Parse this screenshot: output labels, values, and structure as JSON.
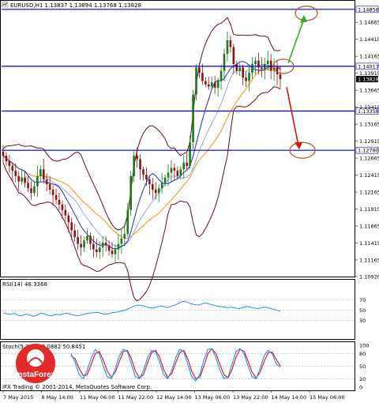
{
  "header": {
    "symbol_line": "EURUSD,H1  1.13837 1.13894 1.13768 1.13828",
    "rsi_label": "RSI(14) 48.3368",
    "stoch_label": "Stoch(5,3,3) 48.0882 50.8451",
    "copyright": "IFX Trading © 2001-2014, MetaQuotes Software Corp."
  },
  "logo": {
    "text": "InstaForex"
  },
  "price_axis": {
    "ticks": [
      "1.14665",
      "1.14415",
      "1.14165",
      "1.13915",
      "1.13665",
      "1.13415",
      "1.13165",
      "1.12915",
      "1.12665",
      "1.12415",
      "1.12165",
      "1.11915",
      "1.11665",
      "1.11415",
      "1.11165",
      "1.10920"
    ],
    "ylim": [
      1.1092,
      1.1497
    ]
  },
  "price_tags": [
    {
      "label": "1.14856",
      "value": 1.14856,
      "style": "level"
    },
    {
      "label": "1.14017",
      "value": 1.14017,
      "style": "level"
    },
    {
      "label": "1.13828",
      "value": 1.13828,
      "style": "current"
    },
    {
      "label": "1.13358",
      "value": 1.13358,
      "style": "level"
    },
    {
      "label": "1.12780",
      "value": 1.1278,
      "style": "level"
    }
  ],
  "rsi_axis": {
    "ticks": [
      "70",
      "50",
      "30"
    ],
    "ylim": [
      0,
      100
    ]
  },
  "stoch_axis": {
    "ticks": [
      "100",
      "80",
      "50",
      "20",
      "0"
    ],
    "ylim": [
      0,
      100
    ]
  },
  "time_axis": {
    "labels": [
      "7 May 2015",
      "8 May 14:00",
      "11 May 06:00",
      "11 May 22:00",
      "12 May 14:00",
      "13 May 06:00",
      "13 May 22:00",
      "14 May 14:00",
      "15 May 06:00"
    ]
  },
  "colors": {
    "bull": "#1a7a1a",
    "bear": "#8b1414",
    "bands": "#6b0f0f",
    "ma_fast": "#1c2fc4",
    "ma_slow": "#e8a020",
    "level_line": "#0000cc",
    "arrow_up": "#2bb02b",
    "arrow_down": "#e01010",
    "circle": "#b06030",
    "rsi": "#1e90ff",
    "stoch_main": "#1e90ff",
    "stoch_signal": "#e01010"
  },
  "chart_data": {
    "type": "candlestick",
    "title": "EURUSD,H1",
    "ylim": [
      1.1092,
      1.1497
    ],
    "closes": [
      1.127,
      1.1262,
      1.1255,
      1.1248,
      1.124,
      1.1232,
      1.1238,
      1.123,
      1.1222,
      1.1215,
      1.1225,
      1.124,
      1.125,
      1.1235,
      1.1228,
      1.122,
      1.1212,
      1.1205,
      1.1198,
      1.119,
      1.1182,
      1.1172,
      1.116,
      1.115,
      1.114,
      1.1135,
      1.1145,
      1.1152,
      1.114,
      1.1132,
      1.1128,
      1.1135,
      1.1142,
      1.1138,
      1.113,
      1.1125,
      1.1132,
      1.114,
      1.1148,
      1.1155,
      1.119,
      1.124,
      1.127,
      1.1265,
      1.125,
      1.1242,
      1.1235,
      1.1228,
      1.122,
      1.1215,
      1.1222,
      1.123,
      1.1238,
      1.1245,
      1.1252,
      1.1248,
      1.124,
      1.125,
      1.126,
      1.1255,
      1.129,
      1.136,
      1.14,
      1.1392,
      1.138,
      1.1375,
      1.1372,
      1.1378,
      1.137,
      1.138,
      1.1395,
      1.142,
      1.144,
      1.143,
      1.1405,
      1.1395,
      1.14,
      1.1385,
      1.138,
      1.1392,
      1.1405,
      1.141,
      1.14,
      1.1398,
      1.1405,
      1.141,
      1.1395,
      1.14,
      1.139,
      1.1383
    ],
    "rsi": [
      45,
      43,
      42,
      44,
      40,
      39,
      42,
      41,
      38,
      40,
      44,
      43,
      40,
      39,
      42,
      41,
      43,
      44,
      42,
      40,
      39,
      41,
      43,
      44,
      45,
      46,
      44,
      42,
      43,
      45,
      46,
      47,
      49,
      51,
      55,
      58,
      60,
      59,
      57,
      55,
      54,
      56,
      58,
      57,
      55,
      58,
      60,
      64,
      67,
      66,
      63,
      61,
      60,
      62,
      64,
      62,
      60,
      58,
      57,
      56,
      55,
      56,
      54,
      53,
      55,
      57,
      56,
      54,
      53,
      55,
      56,
      54,
      52,
      50,
      48
    ],
    "stoch_main": [
      80,
      60,
      30,
      20,
      40,
      70,
      90,
      80,
      50,
      25,
      20,
      45,
      75,
      90,
      85,
      55,
      25,
      20,
      40,
      70,
      88,
      85,
      60,
      30,
      20,
      40,
      70,
      90,
      85,
      55,
      25,
      15,
      30,
      65,
      90,
      92,
      70,
      40,
      20,
      25,
      55,
      85,
      92,
      80,
      50,
      25,
      20,
      45,
      75,
      88,
      80,
      55,
      48
    ],
    "stoch_signal": [
      75,
      68,
      45,
      28,
      30,
      55,
      80,
      85,
      65,
      38,
      24,
      36,
      62,
      85,
      88,
      68,
      38,
      22,
      30,
      58,
      82,
      88,
      72,
      42,
      24,
      32,
      58,
      82,
      88,
      68,
      38,
      20,
      24,
      50,
      80,
      92,
      80,
      54,
      30,
      22,
      42,
      72,
      90,
      86,
      62,
      36,
      22,
      36,
      62,
      82,
      84,
      66,
      51
    ],
    "resistance_levels": [
      1.14856,
      1.14017
    ],
    "support_levels": [
      1.13358,
      1.1278
    ],
    "current_price": 1.13828
  }
}
